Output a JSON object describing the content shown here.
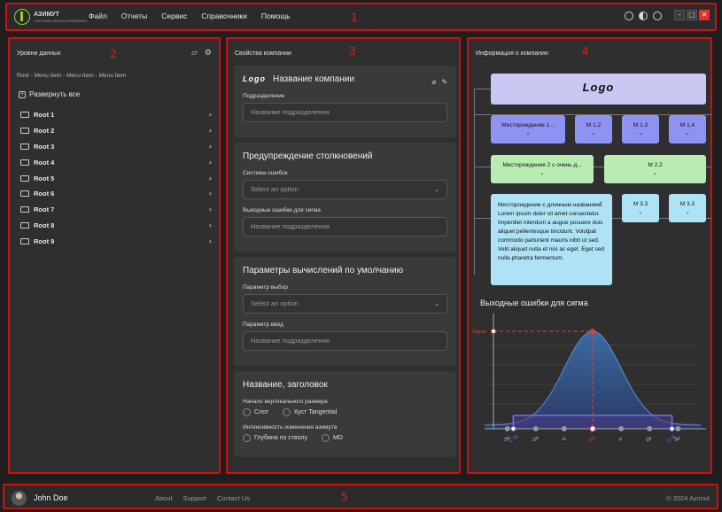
{
  "header": {
    "logo_text": "АЗИМУТ",
    "logo_sub": "СИСТЕМЫ ПРОЕКТИРОВАНИЯ",
    "menu": [
      "Файл",
      "Отчеты",
      "Сервис",
      "Справочники",
      "Помощь"
    ],
    "icons": [
      "user-icon",
      "contrast-icon",
      "globe-icon"
    ],
    "window_buttons": [
      "–",
      "□",
      "✕"
    ]
  },
  "region_labels": [
    "1",
    "2",
    "3",
    "4",
    "5"
  ],
  "left": {
    "title": "Уровни данных",
    "icons": [
      "folder-open-icon",
      "settings-icon"
    ],
    "breadcrumb": "Root - Menu Item - Menu Item - Menu Item",
    "expand_all": "Развернуть все",
    "tree": [
      "Root 1",
      "Root 2",
      "Root 3",
      "Root 4",
      "Root 5",
      "Root 6",
      "Root 7",
      "Root 8",
      "Root 9"
    ]
  },
  "middle": {
    "title": "Свойства компании",
    "card1": {
      "brand": "Logo",
      "title": "Название компании",
      "field_label": "Подразделение",
      "field_placeholder": "Название подразделения"
    },
    "card2": {
      "title": "Предупреждение столкновений",
      "select_label": "Система ошибок",
      "select_placeholder": "Select an option",
      "field_label": "Выходные ошибки для сигма",
      "field_placeholder": "Название подразделения"
    },
    "card3": {
      "title": "Параметры вычислений по умолчанию",
      "select_label": "Параметр выбор",
      "select_placeholder": "Select an option",
      "field_label": "Параметр ввод",
      "field_placeholder": "Название подразделения"
    },
    "card4": {
      "title": "Название, заголовок",
      "radio1_label": "Начало вертикального размера",
      "radio1_options": [
        "Слот",
        "Куст Tangential"
      ],
      "radio2_label": "Интенсивность изменения азимута",
      "radio2_options": [
        "Глубина по стволу",
        "MD"
      ]
    }
  },
  "right": {
    "title": "Информация о компании",
    "org": {
      "top_brand": "Logo",
      "row1": [
        "Месторождение 1...",
        "M 1.2",
        "M 1.3",
        "M 1.4"
      ],
      "row2": [
        "Месторождение 2 с очень д...",
        "M 2.2"
      ],
      "row3_long": "Месторождение с длинным названием Lorem ipsum dolor sit amet consectetur. Imperdiet interdum a augue posuere duis aliquet pellentesque tincidunt. Volutpat commodo parturient mauris nibh ut sed. Velit aliquet nulla et nisi ac eget. Eget sed nulla pharetra fermentum.",
      "row3": [
        "M 3.3",
        "M 3.3"
      ],
      "colors": {
        "top": "#c9c8f2",
        "blue": "#8e92f3",
        "green": "#b8ecb2",
        "cyan": "#aee3f6"
      }
    },
    "chart_title": "Выходные ошибки для сигма"
  },
  "chart_data": {
    "type": "area",
    "title": "Выходные ошибки для сигма",
    "peak_label": "Sigma",
    "x_tick_labels": [
      "-3σ",
      "-2.79",
      "-2σ",
      "-σ",
      "σ/σ",
      "σ",
      "2σ",
      "2.79",
      "3σ"
    ],
    "x_ticks": [
      -3,
      -2.79,
      -2,
      -1,
      0,
      1,
      2,
      2.79,
      3
    ],
    "highlight_range": [
      -2.79,
      2.79
    ],
    "xlim": [
      -3.8,
      3.8
    ],
    "curve": "normal",
    "colors": {
      "fill": "#3d6fa8",
      "range": "#7a6cf0",
      "peak": "#e04040"
    }
  },
  "footer": {
    "user": "John Doe",
    "links": [
      "About",
      "Support",
      "Contact Us"
    ],
    "copyright": "© 2024 Azimut"
  }
}
